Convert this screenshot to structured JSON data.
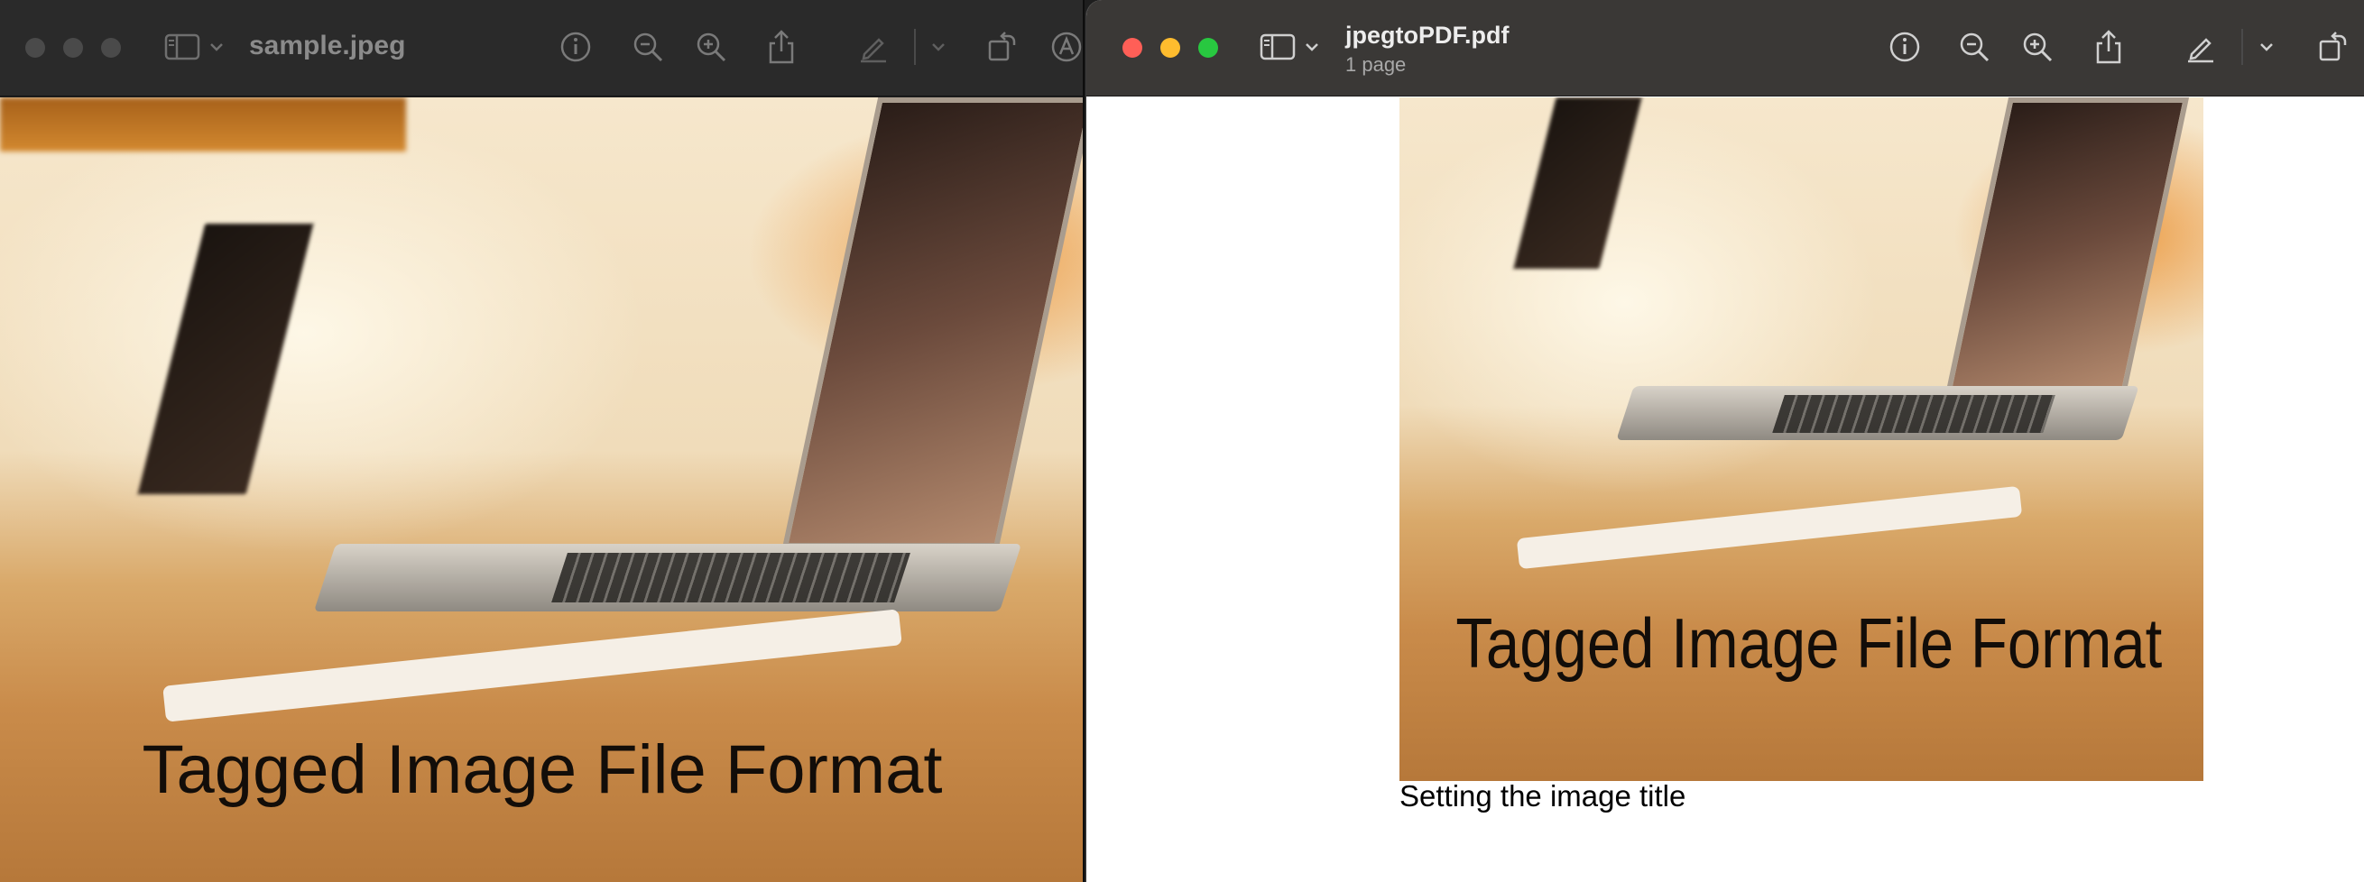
{
  "left_window": {
    "title": "sample.jpeg",
    "image_caption": "Tagged Image File Format"
  },
  "right_window": {
    "title": "jpegtoPDF.pdf",
    "subtitle": "1 page",
    "image_caption": "Tagged Image File Format",
    "pdf_text": "Setting the image title"
  },
  "colors": {
    "close": "#ff5f57",
    "minimize": "#febc2e",
    "zoom": "#28c840",
    "icon": "#c9c9c9",
    "icon_dim": "#7a7a7a"
  },
  "icons": {
    "sidebar": "sidebar-icon",
    "info": "info-icon",
    "zoom_out": "zoom-out-icon",
    "zoom_in": "zoom-in-icon",
    "share": "share-icon",
    "markup": "pencil-icon",
    "rotate": "rotate-icon"
  }
}
